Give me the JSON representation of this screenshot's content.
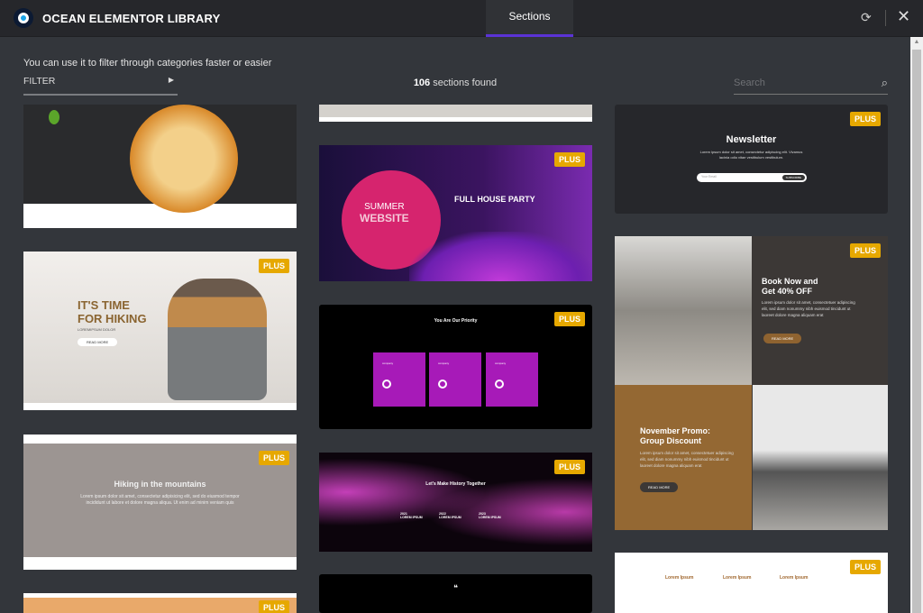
{
  "header": {
    "title": "OCEAN ELEMENTOR LIBRARY",
    "tab": "Sections",
    "sync_icon": "sync-icon",
    "close_icon": "close-icon"
  },
  "toolbar": {
    "hint": "You can use it to filter through categories faster or easier",
    "filter_label": "FILTER",
    "count": "106",
    "count_suffix": " sections found",
    "search_placeholder": "Search"
  },
  "badge": "PLUS",
  "cards": {
    "hiking": {
      "title1": "IT'S TIME",
      "title2": "FOR HIKING",
      "sub": "LOREMIPSUM DOLOR",
      "btn": "READ MORE"
    },
    "mountains": {
      "title": "Hiking in the mountains",
      "text": "Lorem ipsum dolor sit amet, consectetur adipisicing elit, sed do eiusmod tempor incididunt ut labore et dolore magna aliqua. Ut enim ad minim veniam quis"
    },
    "party": {
      "left1": "SUMMER",
      "left2": "WEBSITE",
      "title": "FULL HOUSE PARTY"
    },
    "priority": {
      "title": "You Are Our Priority",
      "box": "company"
    },
    "history": {
      "title": "Let's Make History Together",
      "years": [
        "2021",
        "2022",
        "2023"
      ],
      "label": "LOREM IPSUM"
    },
    "newsletter": {
      "title": "Newsletter",
      "text": "Lorem ipsum dolor sit amet, consectetur adipiscing elit. Vivamus lacinia odio vitae vestibulum vestibulum.",
      "placeholder": "Your Email",
      "btn": "SUBSCRIBE"
    },
    "promo": {
      "t1": "Book Now and",
      "t2": "Get 40% OFF",
      "t3": "November Promo:",
      "t4": "Group Discount",
      "text": "Lorem ipsum dolor sit amet, consectetuer adipiscing elit, sed diam nonummy nibh euismod tincidunt ut laoreet dolore magna aliquam erat",
      "btn": "READ MORE"
    },
    "lorem3": {
      "heads": [
        "Lorem Ipsum",
        "Lorem Ipsum",
        "Lorem Ipsum"
      ]
    }
  },
  "colors": {
    "accent": "#5b33d6",
    "badge": "#e6a800",
    "bg": "#33363b",
    "header": "#26272b"
  }
}
